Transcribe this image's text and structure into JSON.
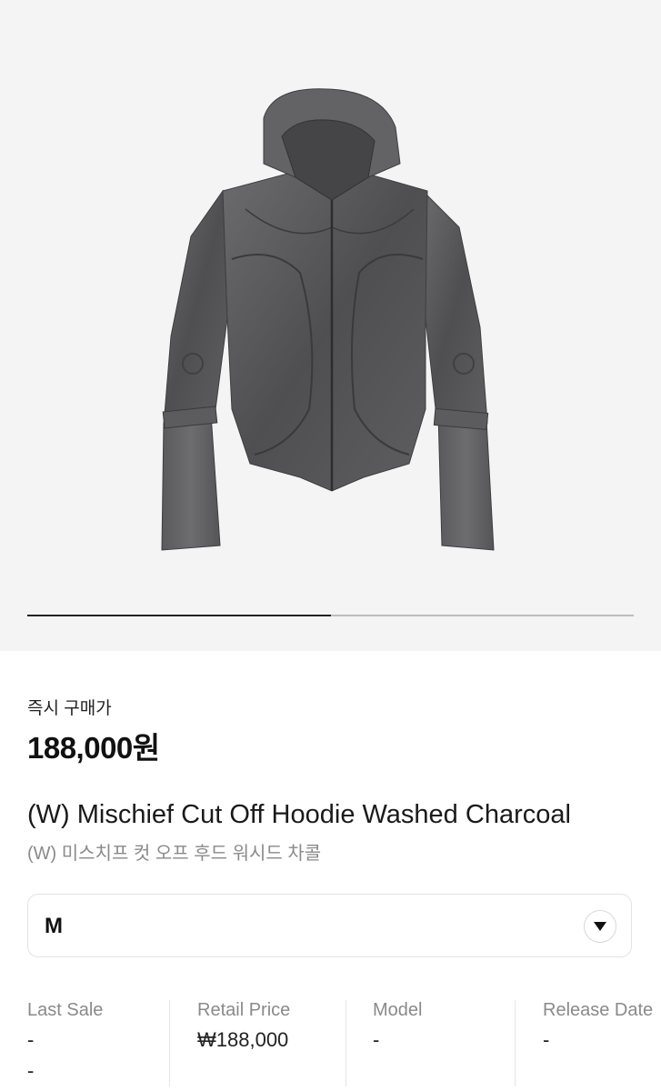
{
  "carousel": {
    "progress": 0.5
  },
  "product": {
    "image_alt": "hoodie-jacket-image",
    "price_label": "즉시 구매가",
    "price": "188,000원",
    "title_en": "(W) Mischief Cut Off Hoodie Washed Charcoal",
    "title_ko": "(W) 미스치프 컷 오프 후드 워시드 차콜"
  },
  "size_select": {
    "value": "M",
    "icon": "triangle-down-icon"
  },
  "stats": [
    {
      "label": "Last Sale",
      "value": "-",
      "value2": "-"
    },
    {
      "label": "Retail Price",
      "value": "₩188,000"
    },
    {
      "label": "Model",
      "value": "-"
    },
    {
      "label": "Release Date",
      "value": "-"
    }
  ],
  "colors": {
    "hero_bg": "#f4f4f4",
    "jacket": "#5a5a5c",
    "track": "#bdbdbd",
    "track_fill": "#222222"
  }
}
